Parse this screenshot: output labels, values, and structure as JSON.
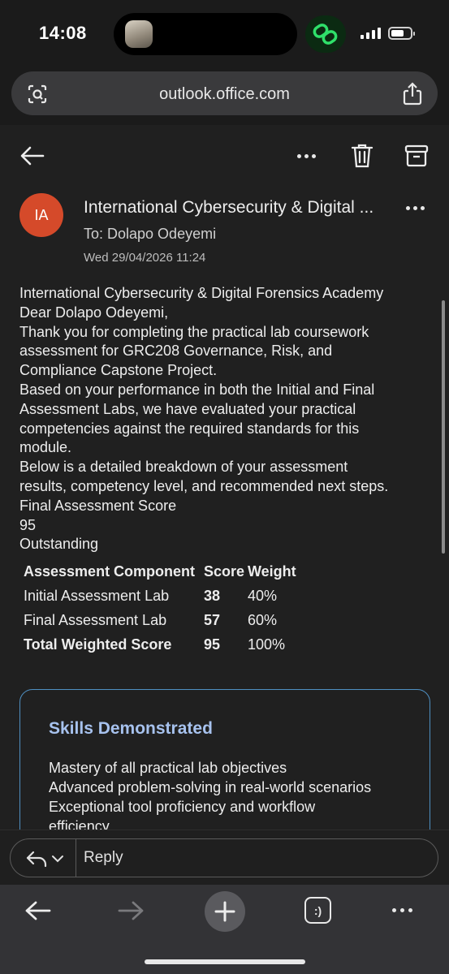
{
  "status_bar": {
    "time": "14:08",
    "battery_level": 0.7
  },
  "browser": {
    "url": "outlook.office.com"
  },
  "toolbar": {
    "actions": [
      "back-icon",
      "more-icon",
      "trash-icon",
      "archive-icon"
    ]
  },
  "email": {
    "avatar_initials": "IA",
    "avatar_color": "#d54a2a",
    "sender": "International Cybersecurity & Digital ...",
    "to": "To: Dolapo Odeyemi",
    "date": "Wed 29/04/2026 11:24",
    "body_lines": [
      "International Cybersecurity & Digital Forensics Academy",
      "Dear Dolapo Odeyemi,",
      "Thank you for completing the practical lab coursework",
      "assessment for GRC208 Governance, Risk, and",
      "Compliance Capstone Project.",
      "Based on your performance in both the Initial and Final",
      "Assessment Labs, we have evaluated your practical",
      "competencies against the required standards for this",
      "module.",
      "Below is a detailed breakdown of your assessment",
      "results, competency level, and recommended next steps.",
      "Final Assessment Score",
      "95",
      "Outstanding"
    ],
    "table": {
      "headers": [
        "Assessment Component",
        "Score",
        "Weight"
      ],
      "rows": [
        [
          "Initial Assessment Lab",
          "38",
          "40%"
        ],
        [
          "Final Assessment Lab",
          "57",
          "60%"
        ],
        [
          "Total Weighted Score",
          "95",
          "100%"
        ]
      ]
    },
    "skills": {
      "title": "Skills Demonstrated",
      "title_color": "#a7c2ee",
      "border_color": "#4f8fc1",
      "items": [
        "Mastery of all practical lab objectives",
        "Advanced problem-solving in real-world scenarios",
        "Exceptional tool proficiency and workflow",
        "efficiency"
      ]
    }
  },
  "reply_bar": {
    "label": "Reply"
  },
  "nav": {
    "tabs_glyph": ":)"
  }
}
